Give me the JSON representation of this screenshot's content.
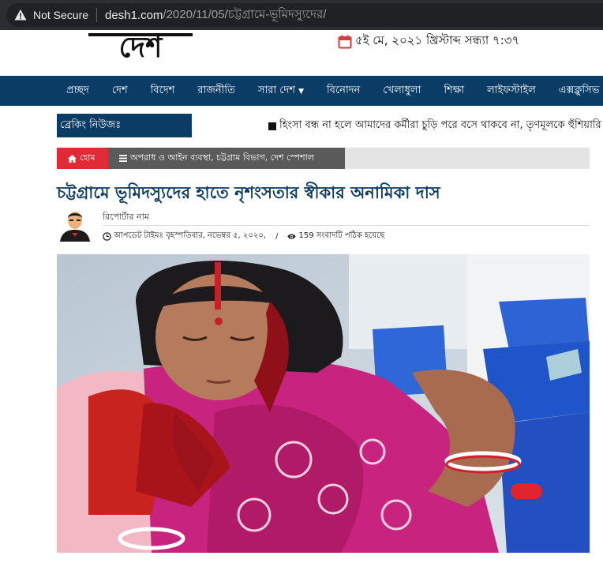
{
  "browser": {
    "security_label": "Not Secure",
    "url_host": "desh1.com",
    "url_path": "/2020/11/05/চট্টগ্রামে-ভূমিদস্যুদের/"
  },
  "header": {
    "logo_text": "দেশ",
    "date_text": "৫ই মে, ২০২১ খ্রিস্টাব্দ সন্ধ্যা ৭:৩৭"
  },
  "nav": {
    "items": [
      "প্রচ্ছদ",
      "দেশ",
      "বিদেশ",
      "রাজনীতি",
      "সারা দেশ",
      "বিনোদন",
      "খেলাধুলা",
      "শিক্ষা",
      "লাইফস্টাইল",
      "এক্সক্লুসিভ"
    ]
  },
  "breaking": {
    "label": "ব্রেকিং নিউজঃ",
    "ticker": "হিংসা বন্ধ না হলে আমাদের কর্মীরা চুড়ি পরে বসে থাকবে না, তৃণমূলকে হুঁশিয়ারি"
  },
  "breadcrumb": {
    "home": "হোম",
    "categories": "অপরাধ ও আইন ব্যবস্থা, চট্টগ্রাম বিভাগ, দেশ স্পেশাল"
  },
  "article": {
    "headline": "চট্টগ্রামে ভূমিদস্যুদের হাতে নৃশংসতার স্বীকার অনামিকা দাস",
    "reporter": "রিপোর্টার নাম",
    "updated": "আপডেট টাইমঃ বৃহস্পতিবার, নভেম্বর ৫, ২০২০,",
    "views": "159 সংবাদটি পঠিক হয়েছে"
  },
  "colors": {
    "nav_bg": "#0b3c66",
    "home_red": "#e02b36",
    "headline_blue": "#0b3c66"
  },
  "icons": [
    "warning-icon",
    "calendar-icon",
    "home-icon",
    "bars-icon",
    "clock-icon",
    "eye-icon"
  ]
}
